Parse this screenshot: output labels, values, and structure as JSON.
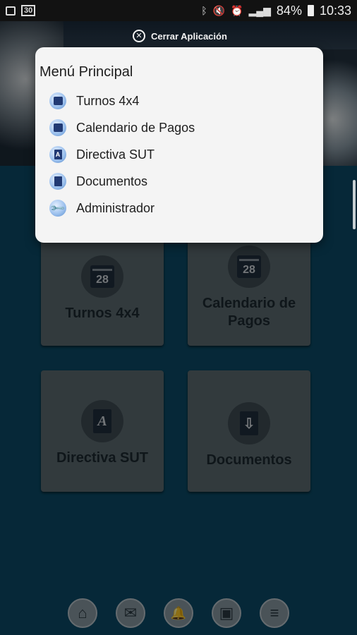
{
  "status_bar": {
    "left_badge": "30",
    "battery": "84%",
    "time": "10:33"
  },
  "header": {
    "close_label": "Cerrar Aplicación"
  },
  "menu": {
    "title": "Menú Principal",
    "items": [
      {
        "label": "Turnos 4x4",
        "icon": "calendar-icon"
      },
      {
        "label": "Calendario de Pagos",
        "icon": "calendar-icon"
      },
      {
        "label": "Directiva SUT",
        "icon": "document-icon"
      },
      {
        "label": "Documentos",
        "icon": "document-icon"
      },
      {
        "label": "Administrador",
        "icon": "wrench-icon"
      }
    ]
  },
  "tiles": [
    {
      "label": "Turnos 4x4",
      "icon": "calendar-icon",
      "day": "28"
    },
    {
      "label": "Calendario de Pagos",
      "icon": "calendar-icon",
      "day": "28"
    },
    {
      "label": "Directiva SUT",
      "icon": "document-icon",
      "glyph": "A"
    },
    {
      "label": "Documentos",
      "icon": "download-document-icon",
      "glyph": "⇩"
    }
  ],
  "bottom_nav": [
    {
      "icon": "home-icon",
      "glyph": "⌂"
    },
    {
      "icon": "mail-icon",
      "glyph": "✉"
    },
    {
      "icon": "bell-icon",
      "glyph": "🔔"
    },
    {
      "icon": "contact-folder-icon",
      "glyph": "▣"
    },
    {
      "icon": "menu-icon",
      "glyph": "≡"
    }
  ]
}
